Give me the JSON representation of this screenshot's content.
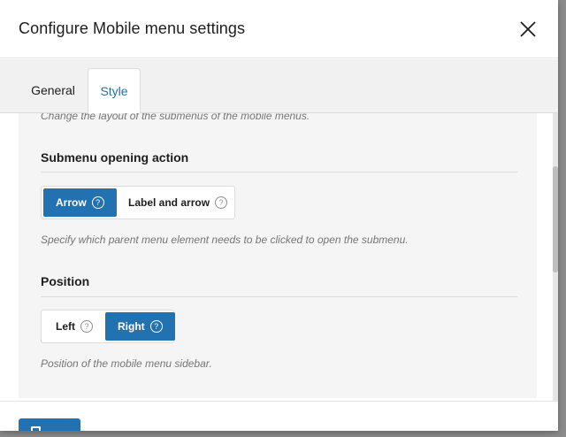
{
  "modal": {
    "title": "Configure Mobile menu settings"
  },
  "tabs": [
    {
      "label": "General"
    },
    {
      "label": "Style"
    }
  ],
  "content": {
    "submenu_layout_desc": "Change the layout of the submenus of the mobile menus.",
    "opening_action": {
      "title": "Submenu opening action",
      "options": [
        {
          "label": "Arrow",
          "help": "?"
        },
        {
          "label": "Label and arrow",
          "help": "?"
        }
      ],
      "selected": "Arrow",
      "desc": "Specify which parent menu element needs to be clicked to open the submenu."
    },
    "position": {
      "title": "Position",
      "options": [
        {
          "label": "Left",
          "help": "?"
        },
        {
          "label": "Right",
          "help": "?"
        }
      ],
      "selected": "Right",
      "desc": "Position of the mobile menu sidebar."
    }
  },
  "colors": {
    "accent": "#2271b1",
    "panel_bg": "#f5f5f5",
    "tabs_bg": "#f1f1f1"
  }
}
